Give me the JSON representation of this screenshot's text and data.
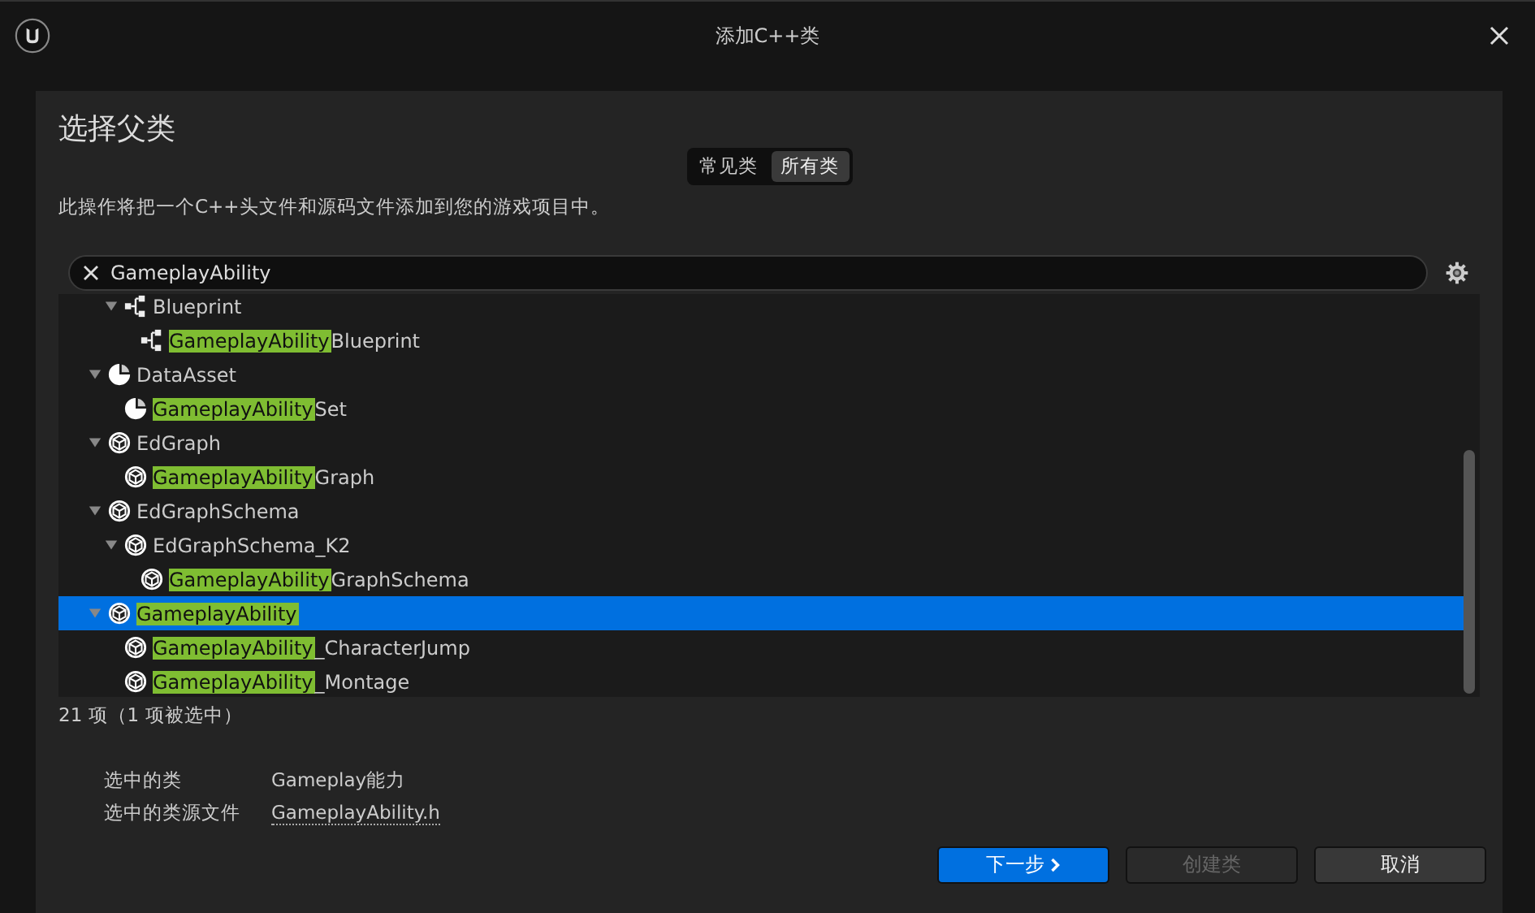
{
  "window": {
    "title": "添加C++类"
  },
  "heading": "选择父类",
  "tabs": [
    {
      "label": "常见类",
      "selected": false
    },
    {
      "label": "所有类",
      "selected": true
    }
  ],
  "description": "此操作将把一个C++头文件和源码文件添加到您的游戏项目中。",
  "search": {
    "value": "GameplayAbility"
  },
  "tree": [
    {
      "children": [
        {
          "kind": "blueprint",
          "rest": "Blueprint",
          "expanded": true,
          "selected": false,
          "children": [
            {
              "kind": "blueprint",
              "match": "GameplayAbility",
              "rest": "Blueprint",
              "selected": false
            }
          ]
        }
      ]
    },
    {
      "kind": "data-asset",
      "rest": "DataAsset",
      "expanded": true,
      "selected": false,
      "children": [
        {
          "kind": "data-asset",
          "match": "GameplayAbility",
          "rest": "Set",
          "selected": false
        }
      ]
    },
    {
      "kind": "class",
      "rest": "EdGraph",
      "expanded": true,
      "selected": false,
      "children": [
        {
          "kind": "class",
          "match": "GameplayAbility",
          "rest": "Graph",
          "selected": false
        }
      ]
    },
    {
      "kind": "class",
      "rest": "EdGraphSchema",
      "expanded": true,
      "selected": false,
      "children": [
        {
          "kind": "class",
          "rest": "EdGraphSchema_K2",
          "expanded": true,
          "selected": false,
          "children": [
            {
              "kind": "class",
              "match": "GameplayAbility",
              "rest": "GraphSchema",
              "selected": false
            }
          ]
        }
      ]
    },
    {
      "kind": "class",
      "match": "GameplayAbility",
      "expanded": true,
      "selected": true,
      "children": [
        {
          "kind": "class",
          "match": "GameplayAbility",
          "rest": "_CharacterJump",
          "selected": false
        },
        {
          "kind": "class",
          "match": "GameplayAbility",
          "rest": "_Montage",
          "selected": false
        }
      ]
    }
  ],
  "count": "21 项（1 项被选中）",
  "details": [
    {
      "label": "选中的类",
      "value": "Gameplay能力",
      "kind": "text"
    },
    {
      "label": "选中的类源文件",
      "value": "GameplayAbility.h",
      "kind": "link"
    }
  ],
  "buttons": [
    {
      "label": "下一步",
      "kind": "primary",
      "chevron": true
    },
    {
      "label": "创建类",
      "kind": "disabled",
      "chevron": false
    },
    {
      "label": "取消",
      "kind": "normal",
      "chevron": false
    }
  ]
}
